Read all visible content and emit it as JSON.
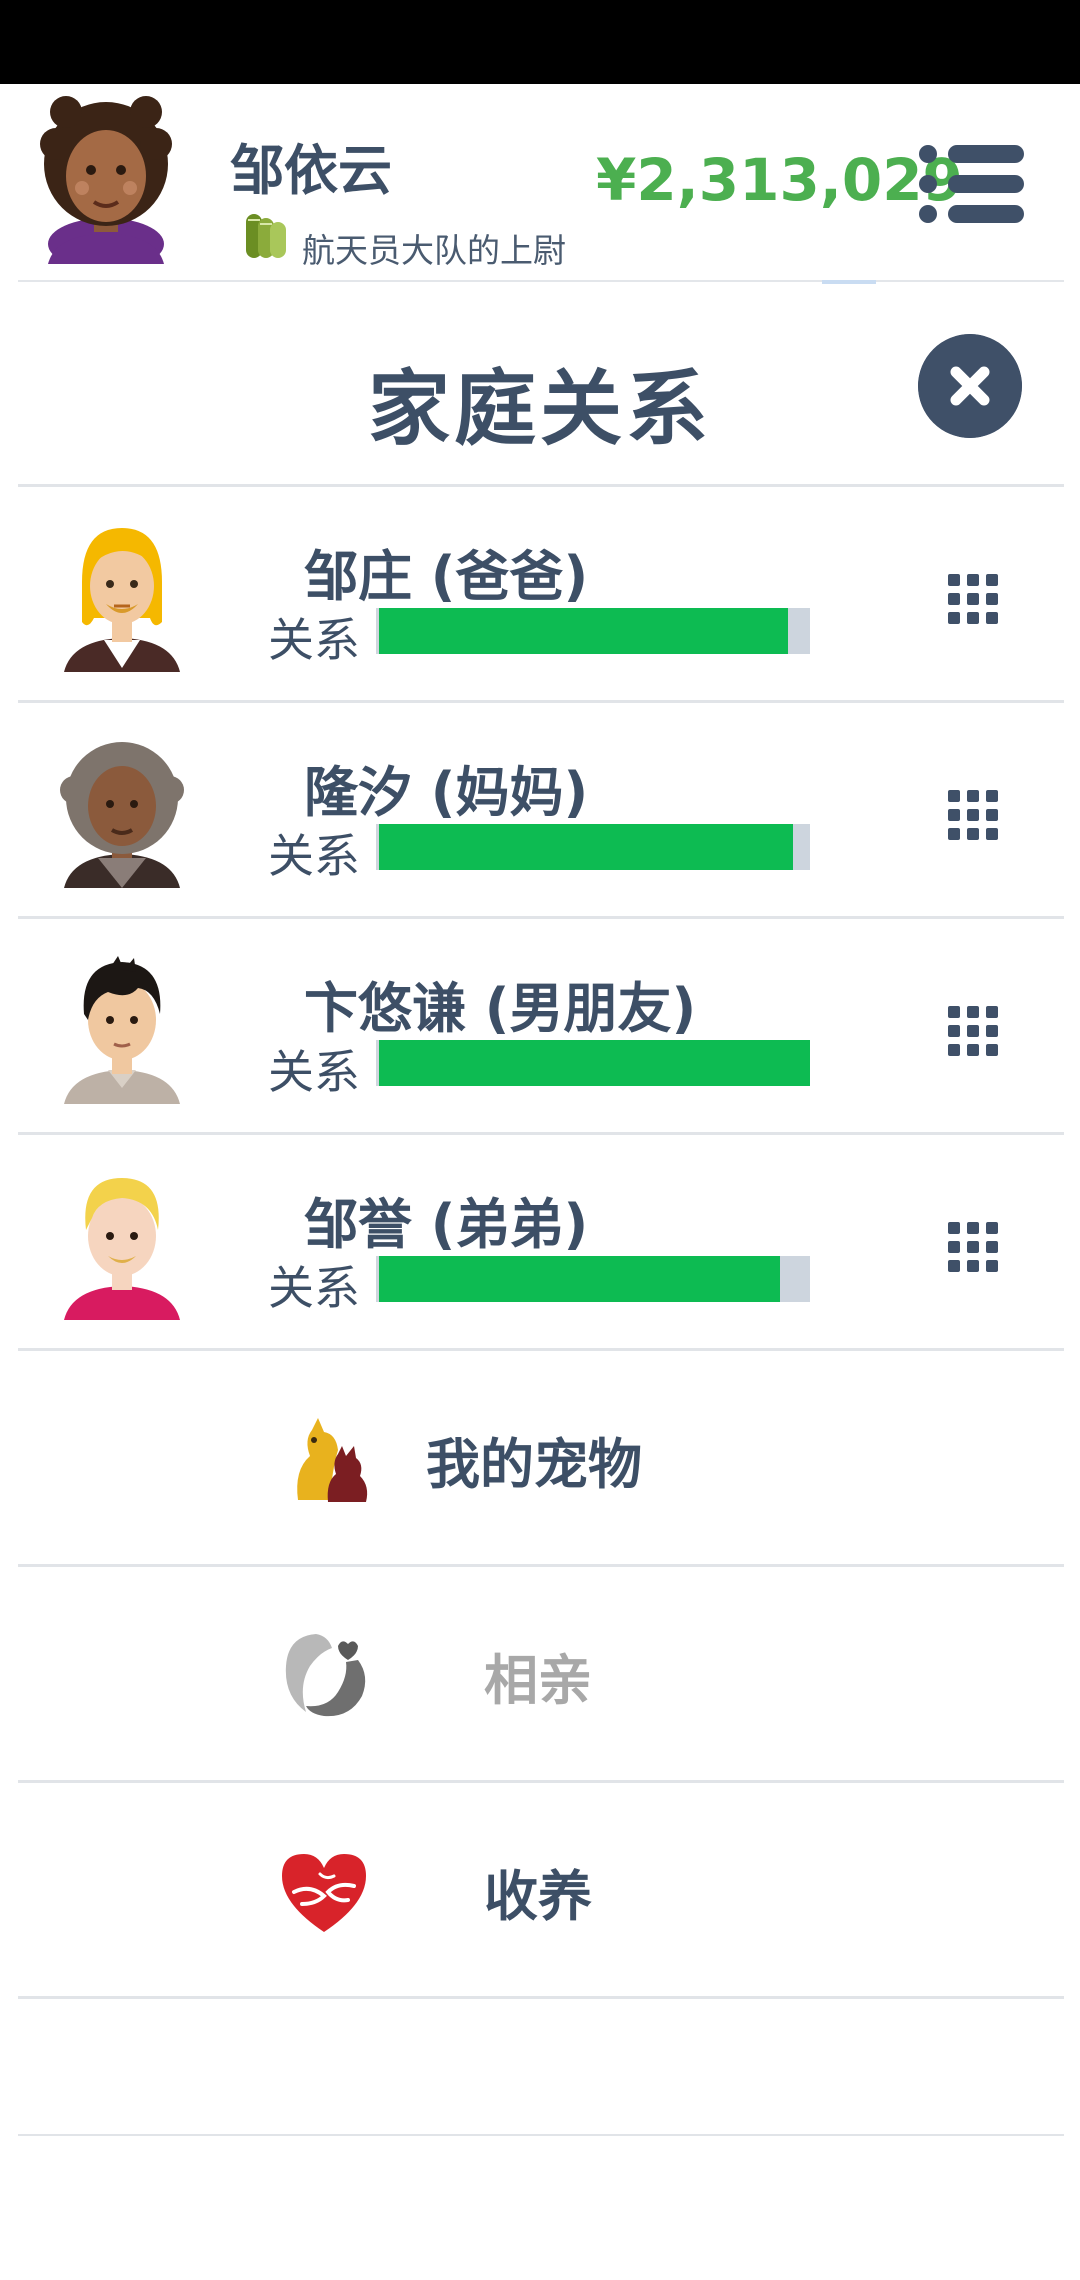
{
  "header": {
    "player_name": "邹依云",
    "rank": "航天员大队的上尉",
    "money": "¥2,313,029",
    "menu_icon": "list-menu-icon"
  },
  "dialog": {
    "title": "家庭关系",
    "close_icon": "close-x-icon"
  },
  "family": [
    {
      "name": "邹庄 (爸爸)",
      "relationship_label": "关系",
      "relationship_level": 0.95,
      "avatar": "blond-father-avatar-icon",
      "menu_icon": "grid-dots-icon"
    },
    {
      "name": "隆汐 (妈妈)",
      "relationship_label": "关系",
      "relationship_level": 0.96,
      "avatar": "gray-haired-mother-avatar-icon",
      "menu_icon": "grid-dots-icon"
    },
    {
      "name": "卞悠谦 (男朋友)",
      "relationship_label": "关系",
      "relationship_level": 1.0,
      "avatar": "dark-haired-boyfriend-avatar-icon",
      "menu_icon": "grid-dots-icon"
    },
    {
      "name": "邹誉 (弟弟)",
      "relationship_label": "关系",
      "relationship_level": 0.93,
      "avatar": "blond-brother-avatar-icon",
      "menu_icon": "grid-dots-icon"
    }
  ],
  "options": [
    {
      "label": "我的宠物",
      "icon": "pets-icon",
      "enabled": true
    },
    {
      "label": "相亲",
      "icon": "dating-icon",
      "enabled": false
    },
    {
      "label": "收养",
      "icon": "adoption-heart-icon",
      "enabled": true
    }
  ],
  "colors": {
    "accent_text": "#3d4f66",
    "money_green": "#4caf50",
    "bar_fill": "#0dbb52",
    "bar_track": "#cdd5de",
    "close_button": "#3f5068"
  }
}
